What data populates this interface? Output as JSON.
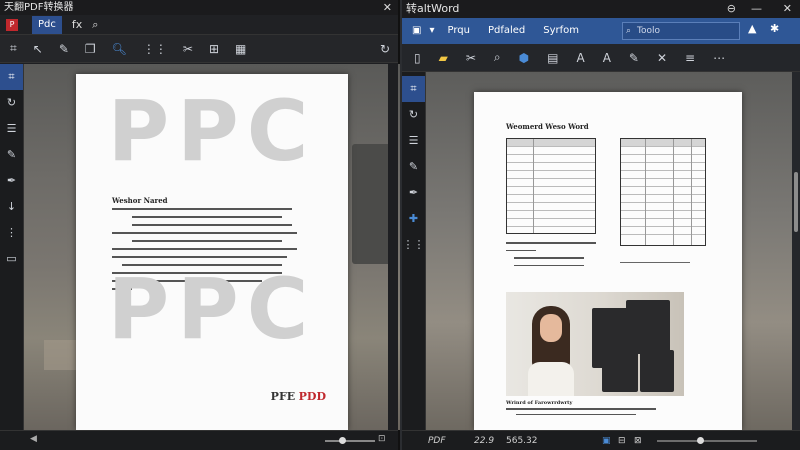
{
  "left_window": {
    "title": "天翻PDF转换器",
    "close_icon": "close-icon",
    "tab_active": "Pdc",
    "tab_fx": "fx",
    "doc": {
      "big_word_top": "PPC",
      "heading": "Weshor Nared",
      "big_word_bottom": "PPC",
      "footer_brand_a": "PFE",
      "footer_brand_b": "PDD"
    }
  },
  "right_window": {
    "title": "转altWord",
    "ribbon_tabs": [
      "Prqu",
      "Pdfaled",
      "Syrfom"
    ],
    "search_placeholder": "Toolo",
    "doc": {
      "heading": "Weomerd Weso Word",
      "photo_caption": "Wrinrd of Farowrrdwrty"
    },
    "status": {
      "format": "PDF",
      "zoom": "22.9",
      "size": "565.32"
    }
  },
  "colors": {
    "ribbon_blue": "#2f5796",
    "pdf_red": "#c0282d"
  }
}
